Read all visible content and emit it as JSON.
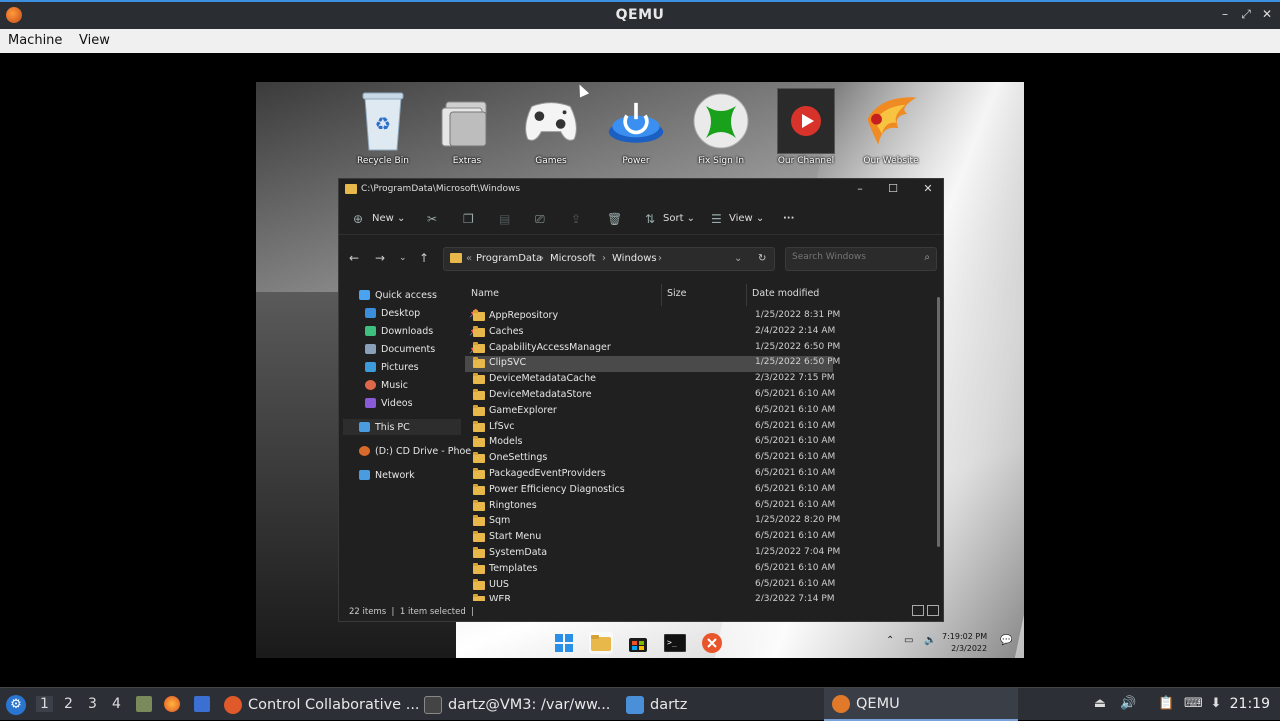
{
  "host": {
    "title": "QEMU",
    "menu": [
      "Machine",
      "View"
    ],
    "window_controls": [
      "–",
      "⤢",
      "✕"
    ]
  },
  "desktop_icons": [
    {
      "label": "Recycle Bin",
      "icon": "recycle-bin-icon"
    },
    {
      "label": "Extras",
      "icon": "folder-stack-icon"
    },
    {
      "label": "Games",
      "icon": "gamepad-icon"
    },
    {
      "label": "Power",
      "icon": "power-icon"
    },
    {
      "label": "Fix Sign In",
      "icon": "xbox-icon"
    },
    {
      "label": "Our Channel",
      "icon": "youtube-icon"
    },
    {
      "label": "Our Website",
      "icon": "phoenix-icon"
    }
  ],
  "explorer": {
    "title": "C:\\ProgramData\\Microsoft\\Windows",
    "window_controls": [
      "–",
      "☐",
      "✕"
    ],
    "toolbar": {
      "new_label": "New",
      "sort_label": "Sort",
      "view_label": "View",
      "more_label": "···"
    },
    "breadcrumb": [
      "ProgramData",
      "Microsoft",
      "Windows"
    ],
    "search_placeholder": "Search Windows",
    "nav": [
      {
        "label": "Quick access",
        "color": "#4aa3f0",
        "pinned": false
      },
      {
        "label": "Desktop",
        "color": "#3b8edb",
        "pinned": true
      },
      {
        "label": "Downloads",
        "color": "#3fbf7f",
        "pinned": true
      },
      {
        "label": "Documents",
        "color": "#8aa0b8",
        "pinned": true
      },
      {
        "label": "Pictures",
        "color": "#3b9bdb",
        "pinned": true
      },
      {
        "label": "Music",
        "color": "#e0684a",
        "pinned": false
      },
      {
        "label": "Videos",
        "color": "#8a5ad8",
        "pinned": false
      },
      {
        "label": "This PC",
        "color": "#4a9be0",
        "pinned": false
      },
      {
        "label": "(D:) CD Drive - Phoe",
        "color": "#d86a2a",
        "pinned": false
      },
      {
        "label": "Network",
        "color": "#4a9be0",
        "pinned": false
      }
    ],
    "columns": {
      "name": "Name",
      "size": "Size",
      "date": "Date modified"
    },
    "files": [
      {
        "name": "AppRepository",
        "date": "1/25/2022 8:31 PM"
      },
      {
        "name": "Caches",
        "date": "2/4/2022 2:14 AM"
      },
      {
        "name": "CapabilityAccessManager",
        "date": "1/25/2022 6:50 PM"
      },
      {
        "name": "ClipSVC",
        "date": "1/25/2022 6:50 PM",
        "selected": true
      },
      {
        "name": "DeviceMetadataCache",
        "date": "2/3/2022 7:15 PM"
      },
      {
        "name": "DeviceMetadataStore",
        "date": "6/5/2021 6:10 AM"
      },
      {
        "name": "GameExplorer",
        "date": "6/5/2021 6:10 AM"
      },
      {
        "name": "LfSvc",
        "date": "6/5/2021 6:10 AM"
      },
      {
        "name": "Models",
        "date": "6/5/2021 6:10 AM"
      },
      {
        "name": "OneSettings",
        "date": "6/5/2021 6:10 AM"
      },
      {
        "name": "PackagedEventProviders",
        "date": "6/5/2021 6:10 AM"
      },
      {
        "name": "Power Efficiency Diagnostics",
        "date": "6/5/2021 6:10 AM"
      },
      {
        "name": "Ringtones",
        "date": "6/5/2021 6:10 AM"
      },
      {
        "name": "Sqm",
        "date": "1/25/2022 8:20 PM"
      },
      {
        "name": "Start Menu",
        "date": "6/5/2021 6:10 AM"
      },
      {
        "name": "SystemData",
        "date": "1/25/2022 7:04 PM"
      },
      {
        "name": "Templates",
        "date": "6/5/2021 6:10 AM"
      },
      {
        "name": "UUS",
        "date": "6/5/2021 6:10 AM"
      },
      {
        "name": "WER",
        "date": "2/3/2022 7:14 PM"
      }
    ],
    "status": {
      "items": "22 items",
      "selected": "1 item selected"
    }
  },
  "guest_taskbar": {
    "time": "7:19:02 PM",
    "date": "2/3/2022"
  },
  "host_taskbar": {
    "workspaces": [
      "1",
      "2",
      "3",
      "4"
    ],
    "tasks": [
      {
        "label": "Control Collaborative ...",
        "color": "#e0592a"
      },
      {
        "label": "dartz@VM3: /var/ww...",
        "color": "#444"
      },
      {
        "label": "dartz",
        "color": "#4a90d9"
      },
      {
        "label": "QEMU",
        "color": "#e07a2a"
      }
    ],
    "clock": "21:19"
  }
}
